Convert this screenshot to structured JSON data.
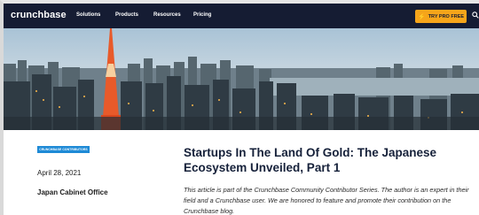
{
  "nav": {
    "logo": "crunchbase",
    "items": [
      "Solutions",
      "Products",
      "Resources",
      "Pricing"
    ],
    "cta_label": "TRY PRO FREE"
  },
  "article": {
    "badge": "CRUNCHBASE CONTRIBUTORS",
    "date": "April 28, 2021",
    "author": "Japan Cabinet Office",
    "title": "Startups In The Land Of Gold: The Japanese Ecosystem Unveiled, Part 1",
    "intro": "This article is part of the Crunchbase Community Contributor Series. The author is an expert in their field and a Crunchbase user. We are honored to feature and promote their contribution on the Crunchbase blog."
  },
  "colors": {
    "nav_bg": "#151c33",
    "cta_bg": "#f6a51a",
    "badge_bg": "#1e8ad6"
  }
}
